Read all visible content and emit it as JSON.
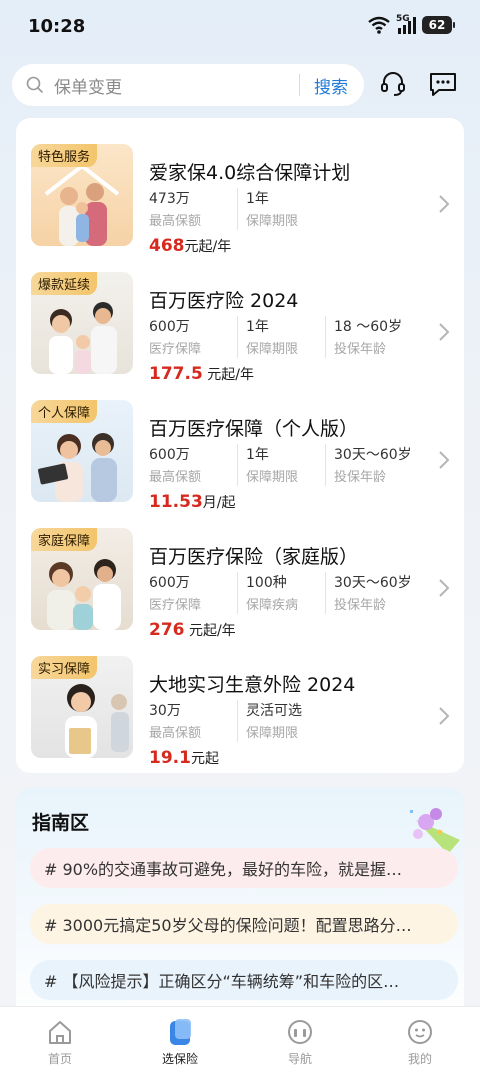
{
  "status_bar": {
    "time": "10:28",
    "network": "5G",
    "battery": "62"
  },
  "header": {
    "search_placeholder": "保单变更",
    "search_button": "搜索",
    "service_icon": "headset-icon",
    "message_icon": "chat-bubble-icon"
  },
  "products": [
    {
      "tag": "特色服务",
      "title": "爱家保4.0综合保障计划",
      "stats": [
        {
          "value": "473万",
          "label": "最高保额"
        },
        {
          "value": "1年",
          "label": "保障期限"
        }
      ],
      "price": "468",
      "price_unit": "元起/年"
    },
    {
      "tag": "爆款延续",
      "title": "百万医疗险 2024",
      "stats": [
        {
          "value": "600万",
          "label": "医疗保障"
        },
        {
          "value": "1年",
          "label": "保障期限"
        },
        {
          "value": "18 ～60岁",
          "label": "投保年龄"
        }
      ],
      "price": "177.5",
      "price_unit": " 元起/年"
    },
    {
      "tag": "个人保障",
      "title": "百万医疗保障（个人版）",
      "stats": [
        {
          "value": "600万",
          "label": "最高保额"
        },
        {
          "value": "1年",
          "label": "保障期限"
        },
        {
          "value": "30天～60岁",
          "label": "投保年龄"
        }
      ],
      "price": "11.53",
      "price_unit": "月/起"
    },
    {
      "tag": "家庭保障",
      "title": "百万医疗保险（家庭版）",
      "stats": [
        {
          "value": "600万",
          "label": "医疗保障"
        },
        {
          "value": "100种",
          "label": "保障疾病"
        },
        {
          "value": "30天～60岁",
          "label": "投保年龄"
        }
      ],
      "price": "276",
      "price_unit": " 元起/年"
    },
    {
      "tag": "实习保障",
      "title": "大地实习生意外险 2024",
      "stats": [
        {
          "value": "30万",
          "label": "最高保额"
        },
        {
          "value": "灵活可选",
          "label": "保障期限"
        }
      ],
      "price": "19.1",
      "price_unit": "元起"
    }
  ],
  "guide": {
    "title": "指南区",
    "items": [
      {
        "text": "# 90%的交通事故可避免，最好的车险，就是握…",
        "bg": "#fdecee"
      },
      {
        "text": "# 3000元搞定50岁父母的保险问题！配置思路分…",
        "bg": "#fdf4e4"
      },
      {
        "text": "# 【风险提示】正确区分“车辆统筹”和车险的区…",
        "bg": "#e8f3fc"
      }
    ]
  },
  "nav": {
    "items": [
      {
        "label": "首页",
        "icon": "home-icon",
        "active": false
      },
      {
        "label": "选保险",
        "icon": "insurance-icon",
        "active": true
      },
      {
        "label": "导航",
        "icon": "navigation-icon",
        "active": false
      },
      {
        "label": "我的",
        "icon": "profile-icon",
        "active": false
      }
    ]
  },
  "colors": {
    "accent": "#1f7ad8",
    "price": "#d62a1f",
    "tag_gold": "#f3c56b"
  }
}
